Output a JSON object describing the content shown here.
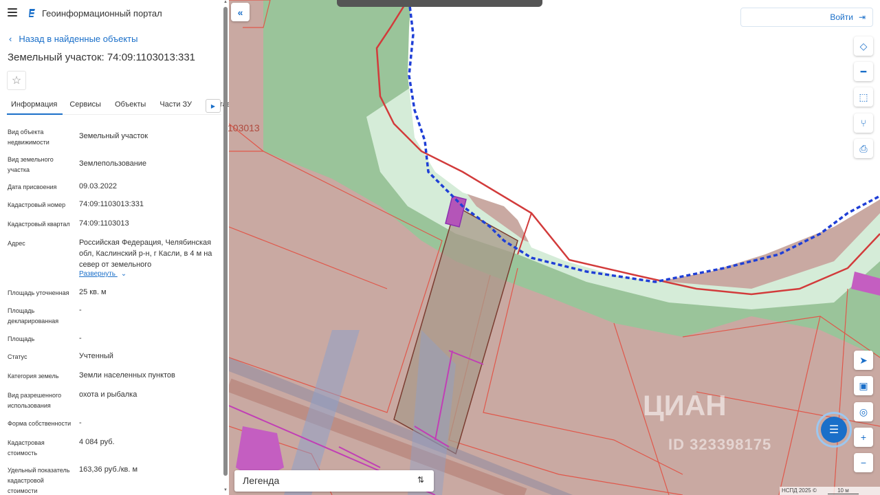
{
  "header": {
    "portal_title": "Геоинформационный портал"
  },
  "back_link": "Назад в найденные объекты",
  "title": "Земельный участок: 74:09:1103013:331",
  "tabs": [
    {
      "label": "Информация"
    },
    {
      "label": "Сервисы"
    },
    {
      "label": "Объекты"
    },
    {
      "label": "Части ЗУ"
    },
    {
      "label": "Состав"
    }
  ],
  "properties": [
    {
      "label": "Вид объекта недвижимости",
      "value": "Земельный участок"
    },
    {
      "label": "Вид земельного участка",
      "value": "Землепользование"
    },
    {
      "label": "Дата присвоения",
      "value": "09.03.2022"
    },
    {
      "label": "Кадастровый номер",
      "value": "74:09:1103013:331"
    },
    {
      "label": "Кадастровый квартал",
      "value": "74:09:1103013"
    },
    {
      "label": "Адрес",
      "value": "Российская Федерация, Челябинская обл, Каслинский р-н, г Касли, в 4 м на север от земельного"
    },
    {
      "label": "Площадь уточненная",
      "value": "25 кв. м"
    },
    {
      "label": "Площадь декларированная",
      "value": "-"
    },
    {
      "label": "Площадь",
      "value": "-"
    },
    {
      "label": "Статус",
      "value": "Учтенный"
    },
    {
      "label": "Категория земель",
      "value": "Земли населенных пунктов"
    },
    {
      "label": "Вид разрешенного использования",
      "value": "охота и рыбалка"
    },
    {
      "label": "Форма собственности",
      "value": "-"
    },
    {
      "label": "Кадастровая стоимость",
      "value": "4 084 руб."
    },
    {
      "label": "Удельный показатель кадастровой стоимости",
      "value": "163,36 руб./кв. м"
    }
  ],
  "expand_label": "Развернуть",
  "map": {
    "login_label": "Войти",
    "legend_label": "Легенда",
    "attribution": "НСПД 2025 ©",
    "scale_label": "10 м",
    "quarter_label": "103013",
    "watermark": "ЦИАН",
    "watermark_id": "ID 323398175"
  },
  "colors": {
    "accent": "#1a6fc9",
    "parcel": "#c9a9a2",
    "green": "#9ac49a",
    "water": "#ffffff",
    "boundary_blue": "#1f3fd6",
    "boundary_red": "#d23b3b"
  },
  "icons": {
    "menu": "hamburger-icon",
    "logo": "portal-logo-icon",
    "back": "chevron-left-icon",
    "favorite": "star-icon",
    "layers": "layers-icon",
    "ruler": "ruler-icon",
    "select": "area-select-icon",
    "share": "share-icon",
    "print": "printer-icon",
    "locate": "navigate-icon",
    "minimap": "minimap-icon",
    "geo": "geo-search-icon",
    "zoom_in": "plus-icon",
    "zoom_out": "minus-icon",
    "chat": "chat-icon"
  }
}
